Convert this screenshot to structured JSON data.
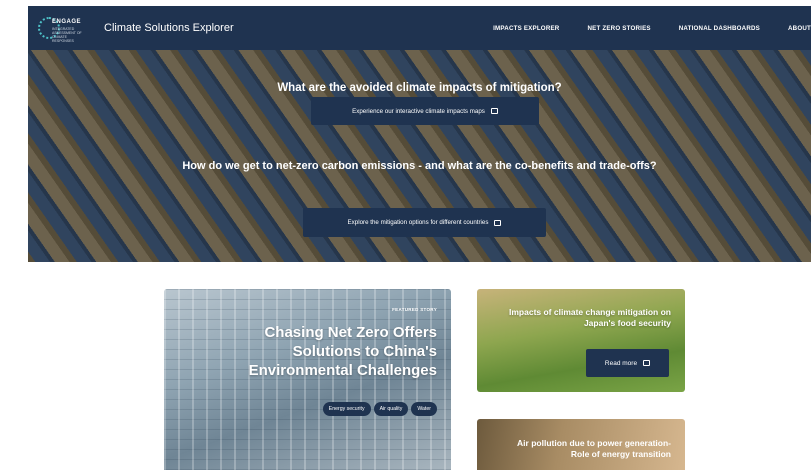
{
  "nav": {
    "logo_title": "ENGAGE",
    "logo_subtitle": "INTEGRATED ASSESSMENT OF CLIMATE RESPONSES",
    "brand": "Climate Solutions Explorer",
    "items": [
      {
        "label": "IMPACTS EXPLORER"
      },
      {
        "label": "NET ZERO STORIES"
      },
      {
        "label": "NATIONAL DASHBOARDS"
      },
      {
        "label": "ABOUT"
      }
    ]
  },
  "hero": {
    "question1": "What are the avoided climate impacts of mitigation?",
    "button1": "Experience our interactive climate impacts maps",
    "button1_icon": "map-icon",
    "question2": "How do we get to net-zero carbon emissions - and what are the co-benefits and trade-offs?",
    "button2": "Explore the mitigation options for different countries",
    "button2_icon": "book-icon"
  },
  "featured_card": {
    "badge": "FEATURED STORY",
    "title": "Chasing Net Zero Offers Solutions to China's Environmental Challenges",
    "tags": [
      "Energy security",
      "Air quality",
      "Water"
    ]
  },
  "japan_card": {
    "title": "Impacts of climate change mitigation on Japan's food security",
    "button": "Read more"
  },
  "air_card": {
    "title": "Air pollution due to power generation-Role of energy transition"
  },
  "colors": {
    "nav_bg": "#1f3350",
    "button_bg": "#1f3350"
  }
}
